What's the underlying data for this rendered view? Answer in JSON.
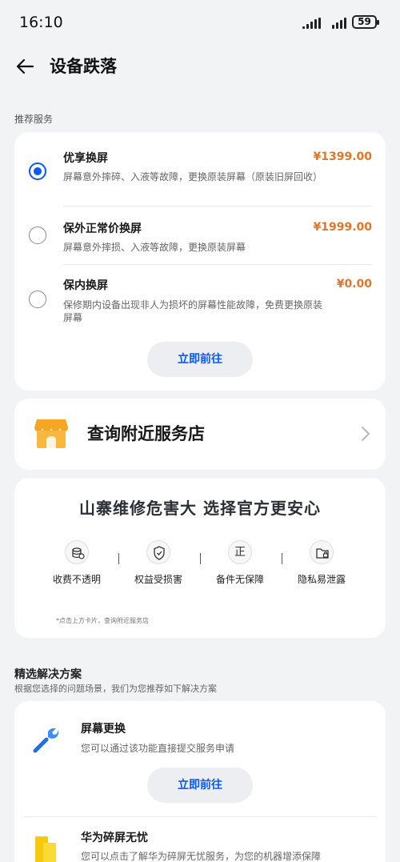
{
  "status": {
    "time": "16:10",
    "battery": "59"
  },
  "header": {
    "title": "设备跌落"
  },
  "recommended": {
    "label": "推荐服务",
    "options": [
      {
        "title": "优享换屏",
        "price": "¥1399.00",
        "desc": "屏幕意外摔碎、入液等故障，更换原装屏幕（原装旧屏回收）",
        "selected": true
      },
      {
        "title": "保外正常价换屏",
        "price": "¥1999.00",
        "desc": "屏幕意外摔损、入液等故障，更换原装屏幕",
        "selected": false
      },
      {
        "title": "保内换屏",
        "price": "¥0.00",
        "desc": "保修期内设备出现非人为损坏的屏幕性能故障，免费更换原装屏幕",
        "selected": false
      }
    ],
    "go_button": "立即前往"
  },
  "store": {
    "label": "查询附近服务店"
  },
  "promo": {
    "title": "山寨维修危害大 选择官方更安心",
    "items": [
      {
        "label": "收费不透明",
        "icon": "coin-stack-icon"
      },
      {
        "label": "权益受损害",
        "icon": "shield-icon"
      },
      {
        "label": "备件无保障",
        "icon": "zheng-icon",
        "glyph": "正"
      },
      {
        "label": "隐私易泄露",
        "icon": "folder-lock-icon"
      }
    ],
    "footnote": "*点击上方卡片，查询附近服务店"
  },
  "solutions": {
    "title": "精选解决方案",
    "subtitle": "根据您选择的问题场景，我们为您推荐如下解决方案",
    "items": [
      {
        "title": "屏幕更换",
        "desc": "您可以通过该功能直接提交服务申请",
        "button": "立即前往",
        "icon": "wrench-icon"
      },
      {
        "title": "华为碎屏无忧",
        "desc": "您可以点击了解华为碎屏无忧服务，为您的机器增添保障",
        "icon": "phone-card-icon"
      }
    ]
  },
  "colors": {
    "accent": "#0a59f7",
    "price": "#e0762b",
    "background": "#f1f3f5"
  }
}
